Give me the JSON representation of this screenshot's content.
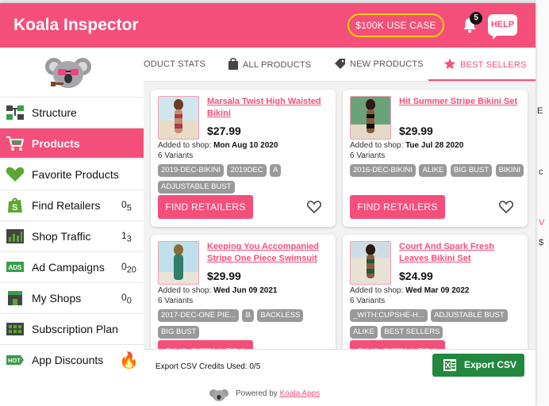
{
  "header": {
    "title": "Koala Inspector",
    "use_case_button": "$100K USE CASE",
    "notification_count": "5",
    "help_label": "HELP"
  },
  "sidebar": {
    "items": [
      {
        "label": "Structure",
        "count": "",
        "icon": "structure-icon",
        "active": false
      },
      {
        "label": "Products",
        "count": "",
        "icon": "cart-icon",
        "active": true
      },
      {
        "label": "Favorite Products",
        "count": "",
        "icon": "heart-icon",
        "active": false
      },
      {
        "label": "Find Retailers",
        "count": "0",
        "count_of": "5",
        "icon": "shopify-bag-icon",
        "active": false
      },
      {
        "label": "Shop Traffic",
        "count": "1",
        "count_of": "3",
        "icon": "traffic-icon",
        "active": false
      },
      {
        "label": "Ad Campaigns",
        "count": "0",
        "count_of": "20",
        "icon": "ads-icon",
        "active": false
      },
      {
        "label": "My Shops",
        "count": "0",
        "count_of": "0",
        "icon": "shop-icon",
        "active": false
      },
      {
        "label": "Subscription Plan",
        "count": "",
        "icon": "plan-icon",
        "active": false
      },
      {
        "label": "App Discounts",
        "count": "",
        "icon": "hot-icon",
        "active": false
      }
    ]
  },
  "tabs": [
    {
      "label": "ODUCT STATS",
      "icon": ""
    },
    {
      "label": "ALL PRODUCTS",
      "icon": "bag-icon"
    },
    {
      "label": "NEW PRODUCTS",
      "icon": "tag-icon"
    },
    {
      "label": "BEST SELLERS",
      "icon": "star-icon",
      "active": true
    }
  ],
  "products": [
    {
      "name": "Marsala Twist High Waisted Bikini",
      "price": "$27.99",
      "added_label": "Added to shop:",
      "added_date": "Mon Aug 10 2020",
      "variants": "6 Variants",
      "tags": [
        "2019-DEC-BIKINI",
        "2019DEC",
        "A",
        "ADJUSTABLE BUST"
      ],
      "button": "FIND RETAILERS"
    },
    {
      "name": "Hit Summer Stripe Bikini Set",
      "price": "$29.99",
      "added_label": "Added to shop:",
      "added_date": "Tue Jul 28 2020",
      "variants": "6 Variants",
      "tags": [
        "2016-DEC-BIKINI",
        "ALIKE",
        "BIG BUST",
        "BIKINI"
      ],
      "button": "FIND RETAILERS"
    },
    {
      "name": "Keeping You Accompanied Stripe One Piece Swimsuit",
      "price": "$29.99",
      "added_label": "Added to shop:",
      "added_date": "Wed Jun 09 2021",
      "variants": "6 Variants",
      "tags": [
        "2017-DEC-ONE PIE...",
        "B",
        "BACKLESS",
        "BIG BUST"
      ],
      "button": "FIND RETAILERS"
    },
    {
      "name": "Court And Spark Fresh Leaves Bikini Set",
      "price": "$24.99",
      "added_label": "Added to shop:",
      "added_date": "Wed Mar 09 2022",
      "variants": "6 Variants",
      "tags": [
        "_WITH:CUPSHE-H...",
        "ADJUSTABLE BUST",
        "ALIKE",
        "BEST SELLERS"
      ],
      "button": "FIND RETAILERS"
    }
  ],
  "footer": {
    "credits": "Export CSV Credits Used: 0/5",
    "export_label": "Export CSV",
    "powered_prefix": "Powered by",
    "powered_link": "Koala Apps"
  },
  "colors": {
    "brand_pink": "#f44f7a",
    "export_green": "#23883f",
    "use_case_border": "#f5d300",
    "tag_gray": "#999999"
  }
}
